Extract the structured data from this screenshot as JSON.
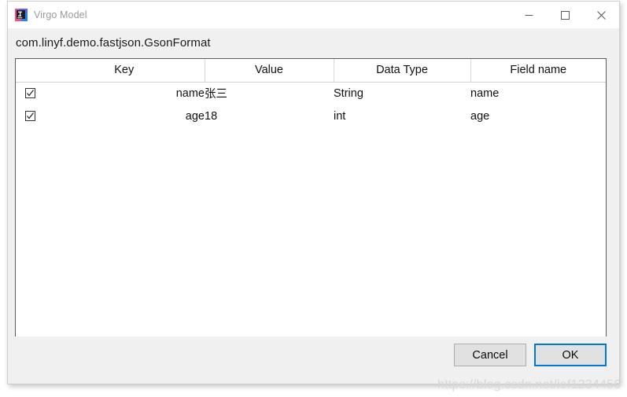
{
  "window": {
    "title": "Virgo Model",
    "icon": "intellij-idea-icon",
    "controls": {
      "minimize": "minimize-icon",
      "maximize": "maximize-icon",
      "close": "close-icon"
    }
  },
  "main": {
    "class_name": "com.linyf.demo.fastjson.GsonFormat"
  },
  "table": {
    "columns": [
      {
        "id": "check",
        "label": ""
      },
      {
        "id": "key",
        "label": "Key"
      },
      {
        "id": "value",
        "label": "Value"
      },
      {
        "id": "type",
        "label": "Data Type"
      },
      {
        "id": "field",
        "label": "Field name"
      }
    ],
    "rows": [
      {
        "checked": true,
        "key": "name",
        "value": "张三",
        "type": "String",
        "field": "name"
      },
      {
        "checked": true,
        "key": "age",
        "value": "18",
        "type": "int",
        "field": "age"
      }
    ]
  },
  "footer": {
    "cancel_label": "Cancel",
    "ok_label": "OK"
  },
  "watermark": {
    "text": "https://blog.csdn.net/ief1234456"
  },
  "colors": {
    "accent": "#0078d7",
    "window_bg": "#f0f0f0",
    "table_bg": "#ffffff",
    "button_bg": "#e1e1e1"
  }
}
